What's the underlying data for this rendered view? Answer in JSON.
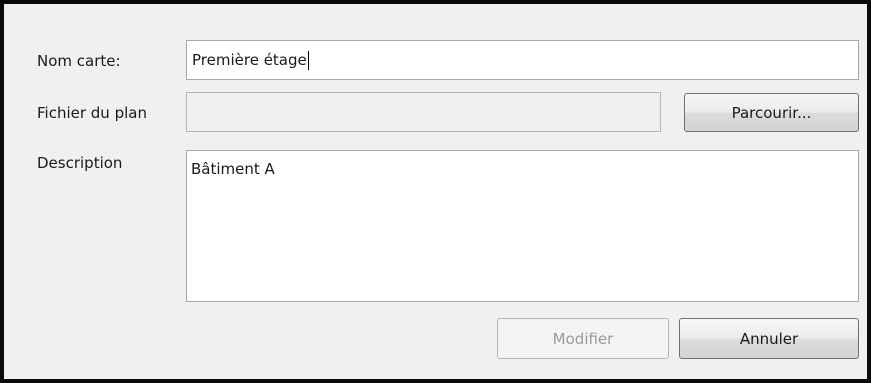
{
  "form": {
    "name_label": "Nom carte:",
    "name_value": "Première étage",
    "plan_file_label": "Fichier du plan",
    "plan_file_value": "",
    "browse_label": "Parcourir...",
    "description_label": "Description",
    "description_value": "Bâtiment A"
  },
  "actions": {
    "modify_label": "Modifier",
    "cancel_label": "Annuler"
  }
}
